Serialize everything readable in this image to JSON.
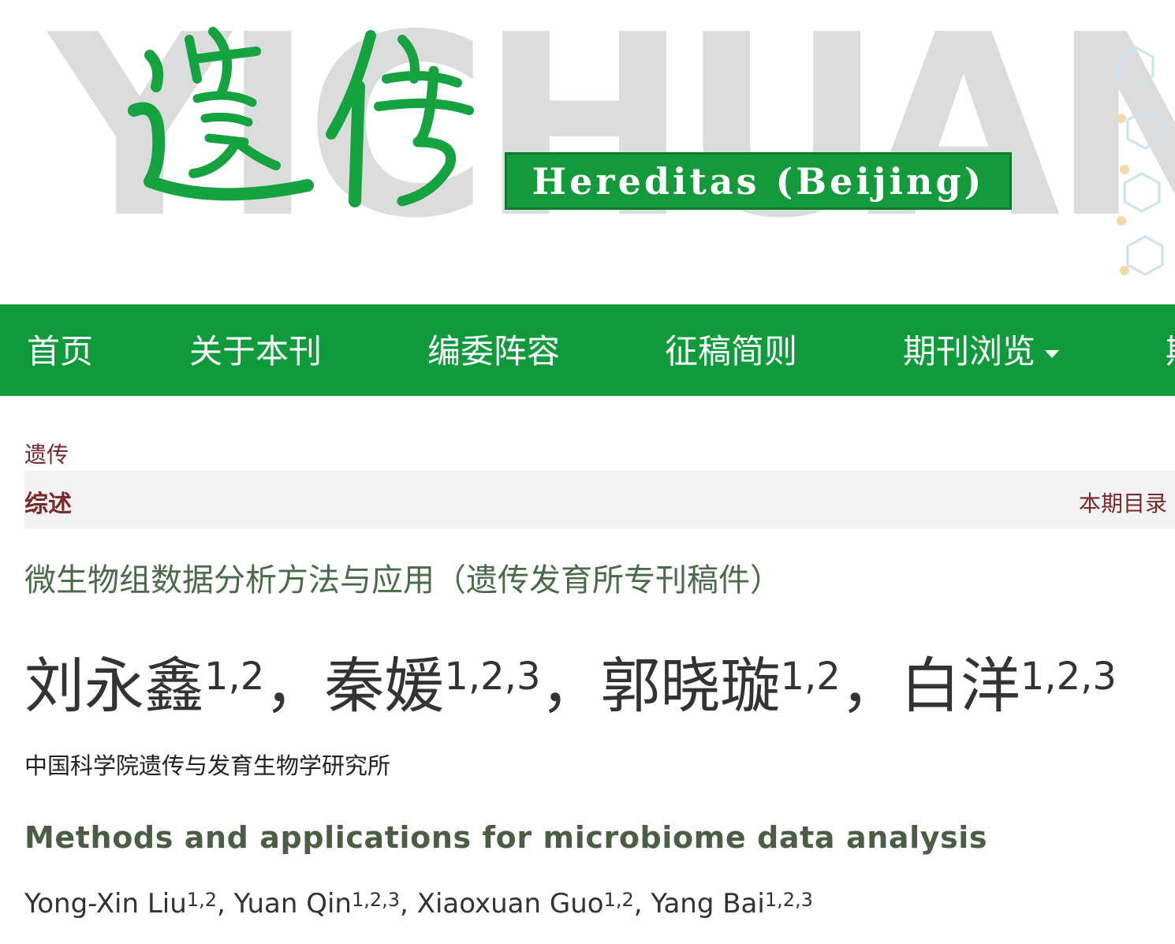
{
  "banner": {
    "watermark": "YICHUAN",
    "logo_cn": "遗传",
    "logo_en": "Hereditas (Beijing)"
  },
  "nav": {
    "items": [
      {
        "label": "首页"
      },
      {
        "label": "关于本刊"
      },
      {
        "label": "编委阵容"
      },
      {
        "label": "征稿简则"
      },
      {
        "label": "期刊浏览"
      },
      {
        "label": "期"
      }
    ]
  },
  "article": {
    "journal": "遗传",
    "section": "综述",
    "toc_link": "本期目录",
    "cn_title": "微生物组数据分析方法与应用（遗传发育所专刊稿件）",
    "cn_authors": [
      {
        "name": "刘永鑫",
        "sup": "1,2"
      },
      {
        "name": "秦媛",
        "sup": "1,2,3"
      },
      {
        "name": "郭晓璇",
        "sup": "1,2"
      },
      {
        "name": "白洋",
        "sup": "1,2,3"
      }
    ],
    "cn_separator": "，",
    "cn_affiliation": "中国科学院遗传与发育生物学研究所",
    "en_title": "Methods and applications for microbiome data analysis",
    "en_authors": [
      {
        "name": "Yong-Xin Liu",
        "sup": "1,2"
      },
      {
        "name": "Yuan Qin",
        "sup": "1,2,3"
      },
      {
        "name": "Xiaoxuan Guo",
        "sup": "1,2"
      },
      {
        "name": "Yang Bai",
        "sup": "1,2,3"
      }
    ],
    "en_separator": ", "
  },
  "colors": {
    "nav_green": "#0f9b3b",
    "logo_green": "#139a3a",
    "link_maroon": "#7a2a2a",
    "title_green_gray": "#4a6a4a"
  }
}
